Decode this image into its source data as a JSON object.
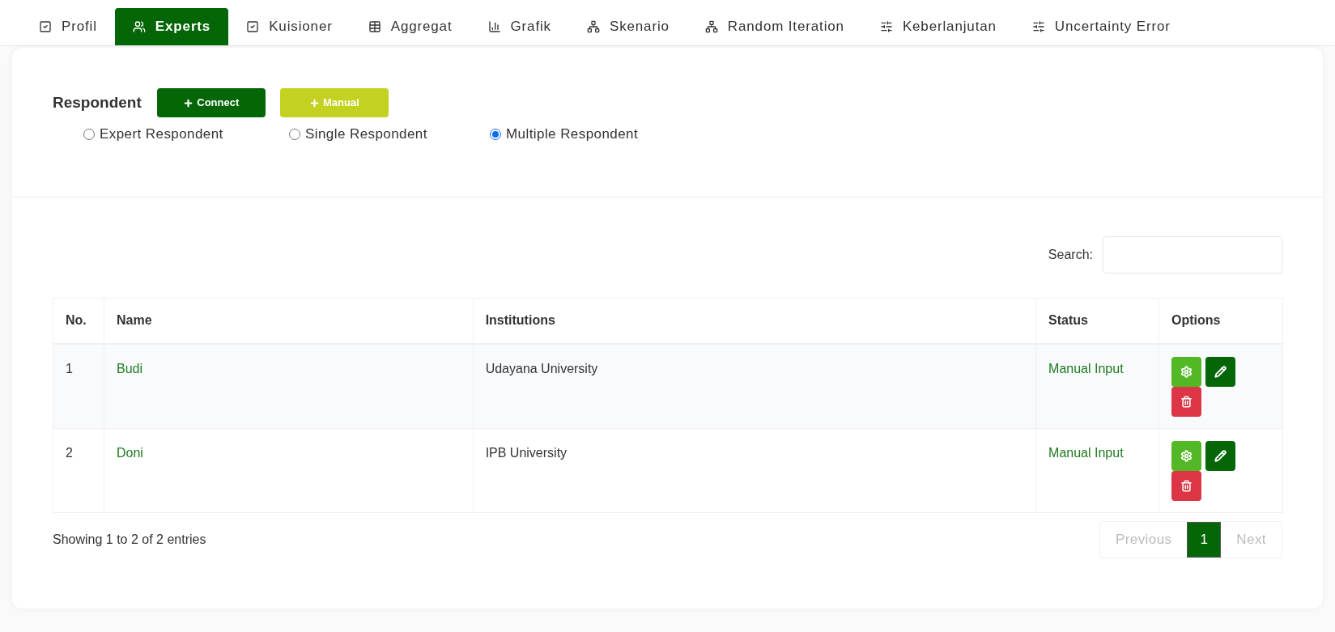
{
  "tabs": [
    {
      "label": "Profil",
      "kind": "check",
      "selected": false
    },
    {
      "label": "Experts",
      "kind": "users",
      "selected": true
    },
    {
      "label": "Kuisioner",
      "kind": "check",
      "selected": false
    },
    {
      "label": "Aggregat",
      "kind": "table",
      "selected": false
    },
    {
      "label": "Grafik",
      "kind": "chart",
      "selected": false
    },
    {
      "label": "Skenario",
      "kind": "sitemap",
      "selected": false
    },
    {
      "label": "Random Iteration",
      "kind": "sitemap",
      "selected": false
    },
    {
      "label": "Keberlanjutan",
      "kind": "sliders",
      "selected": false
    },
    {
      "label": "Uncertainty Error",
      "kind": "sliders",
      "selected": false
    }
  ],
  "respondent": {
    "title": "Respondent",
    "buttons": [
      {
        "label": "Connect",
        "kind": "primary"
      },
      {
        "label": "Manual",
        "kind": "secondary"
      }
    ],
    "options": [
      {
        "label": "Expert Respondent",
        "selected": false
      },
      {
        "label": "Single Respondent",
        "selected": false
      },
      {
        "label": "Multiple Respondent",
        "selected": true
      }
    ]
  },
  "search": {
    "label": "Search:"
  },
  "table": {
    "columns": [
      "No.",
      "Name",
      "Institutions",
      "Status",
      "Options"
    ],
    "rows": [
      {
        "no": "1",
        "name": "Budi",
        "institution": "Udayana University",
        "status": "Manual Input"
      },
      {
        "no": "2",
        "name": "Doni",
        "institution": "IPB University",
        "status": "Manual Input"
      }
    ]
  },
  "info": "Showing 1 to 2 of 2 entries",
  "pagination": [
    {
      "label": "Previous",
      "disabled": true,
      "selected": false
    },
    {
      "label": "1",
      "disabled": false,
      "selected": true
    },
    {
      "label": "Next",
      "disabled": true,
      "selected": false
    }
  ]
}
